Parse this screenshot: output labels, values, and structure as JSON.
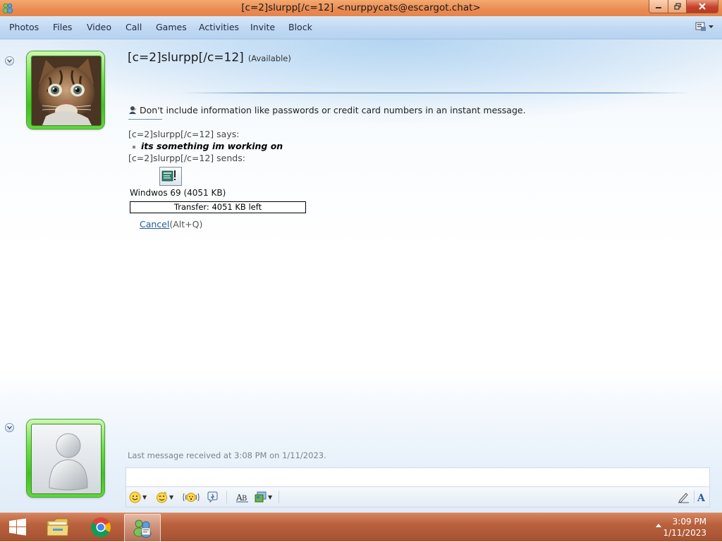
{
  "window": {
    "title": "[c=2]slurpp[/c=12] <nurppycats@escargot.chat>"
  },
  "menu": {
    "items": [
      "Photos",
      "Files",
      "Video",
      "Call",
      "Games",
      "Activities",
      "Invite",
      "Block"
    ]
  },
  "contact": {
    "name": "[c=2]slurpp[/c=12]",
    "status": "(Available)"
  },
  "conversation": {
    "warning": "Don't include information like passwords or credit card numbers in an instant message.",
    "says_label": "[c=2]slurpp[/c=12] says:",
    "message": "its something im working on",
    "sends_label": "[c=2]slurpp[/c=12] sends:",
    "file_name": "Windwos 69 (4051 KB)",
    "transfer_status": "Transfer: 4051 KB left",
    "cancel_label": "Cancel",
    "cancel_shortcut": "(Alt+Q)",
    "last_message": "Last message received at 3:08 PM on 1/11/2023."
  },
  "input": {
    "value": ""
  },
  "taskbar": {
    "time": "3:09 PM",
    "date": "1/11/2023"
  },
  "colors": {
    "titlebar": "#e98a52",
    "taskbar": "#b9613d",
    "avatar_frame": "#4ccd2a",
    "link": "#1f5b9b"
  },
  "icons": {
    "titlebar": "messenger-icon",
    "emoticon": "smiley-icon",
    "wink": "wink-icon",
    "nudge": "nudge-icon",
    "voice_clip": "voice-clip-icon",
    "font": "font-icon",
    "background": "background-icon",
    "handwriting": "handwriting-icon",
    "text_format": "text-format-icon"
  }
}
